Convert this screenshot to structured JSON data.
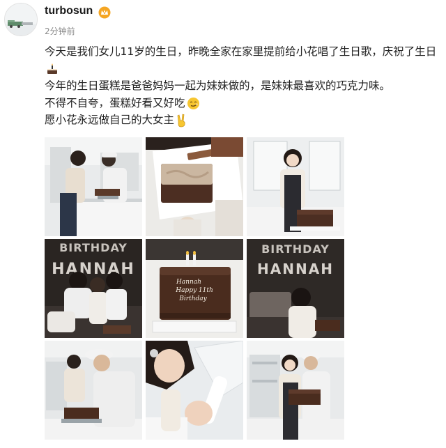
{
  "post": {
    "username": "turbosun",
    "timestamp": "2分钟前",
    "lines": [
      "今天是我们女儿11岁的生日，昨晚全家在家里提前给小花唱了生日歌，庆祝了生日",
      "今年的生日蛋糕是爸爸妈妈一起为妹妹做的，是妹妹最喜欢的巧克力味。",
      "不得不自夸，蛋糕好看又好吃",
      "愿小花永远做自己的大女主"
    ],
    "emojis": [
      "birthday-cake-emoji",
      "smirk-emoji",
      "victory-hand-emoji"
    ]
  },
  "photos": {
    "p4_banner_top": "BIRTHDAY",
    "p4_banner_bottom": "HANNAH",
    "p5_cake_line1": "Hannah",
    "p5_cake_line2": "Happy 11th",
    "p5_cake_line3": "Birthday",
    "p6_banner_top": "BIRTHDAY",
    "p6_banner_bottom": "HANNAH"
  },
  "colors": {
    "username": "#1a1a1a",
    "timestamp": "#8a8a8a",
    "badge": "#f5a623",
    "chocolate": "#4a2c1e"
  }
}
